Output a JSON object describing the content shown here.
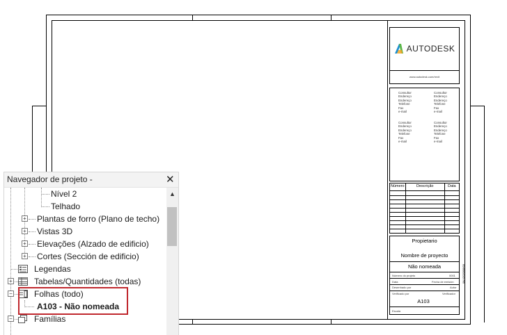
{
  "sheet": {
    "logo_text": "AUTODESK",
    "logo_url": "www.autodesk.com/revit",
    "consultant_lines": [
      "Consultor",
      "Endereço",
      "Endereço",
      "Telefone",
      "Fax",
      "e-mail"
    ],
    "revision_headers": {
      "number": "Número",
      "description": "Descrição",
      "date": "Data"
    },
    "owner": "Propietario",
    "project_name": "Nombre de proyecto",
    "sheet_name": "Não nomeada",
    "project_number_label": "Número do projeto",
    "project_number_value": "0001",
    "date_label": "Data",
    "date_value": "Fecha de emisión",
    "drawn_by_label": "Desenhado por",
    "drawn_by_value": "Autor",
    "checked_by_label": "Verificado por",
    "checked_by_value": "Verificador",
    "sheet_number": "A103",
    "scale_label": "Escala",
    "vertical_stamp": "04/-/2020/08/03"
  },
  "browser": {
    "title": "Navegador de projeto -",
    "items": {
      "nivel2": "Nível 2",
      "telhado": "Telhado",
      "plantas_forro": "Plantas de forro (Plano de techo)",
      "vistas_3d": "Vistas 3D",
      "elevacoes": "Elevações (Alzado de edificio)",
      "cortes": "Cortes (Sección de edificio)",
      "legendas": "Legendas",
      "tabelas": "Tabelas/Quantidades (todas)",
      "folhas": "Folhas (todo)",
      "a103": "A103 - Não nomeada",
      "familias": "Famílias"
    }
  },
  "colors": {
    "highlight": "#c0272d",
    "scrollbar_thumb": "#c1c1c1"
  }
}
